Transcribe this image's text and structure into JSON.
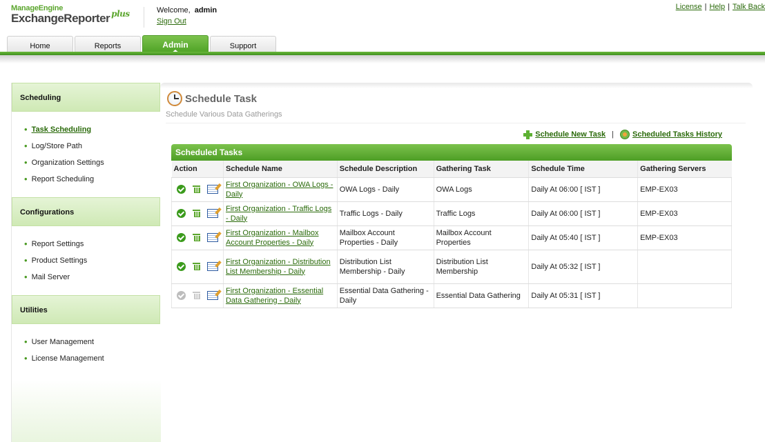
{
  "app": {
    "brand_top": "ManageEngine",
    "brand_main": "ExchangeReporter",
    "brand_plus": "plus"
  },
  "user": {
    "welcome_label": "Welcome,",
    "username": "admin",
    "signout_label": "Sign Out"
  },
  "top_links": {
    "license": "License",
    "help": "Help",
    "talkback": "Talk Back",
    "separator": "|"
  },
  "tabs": [
    {
      "label": "Home",
      "active": false
    },
    {
      "label": "Reports",
      "active": false
    },
    {
      "label": "Admin",
      "active": true
    },
    {
      "label": "Support",
      "active": false
    }
  ],
  "sidebar": {
    "sections": [
      {
        "title": "Scheduling",
        "items": [
          {
            "label": "Task Scheduling",
            "active": true
          },
          {
            "label": "Log/Store Path",
            "active": false
          },
          {
            "label": "Organization Settings",
            "active": false
          },
          {
            "label": "Report Scheduling",
            "active": false
          }
        ]
      },
      {
        "title": "Configurations",
        "items": [
          {
            "label": "Report Settings",
            "active": false
          },
          {
            "label": "Product Settings",
            "active": false
          },
          {
            "label": "Mail Server",
            "active": false
          }
        ]
      },
      {
        "title": "Utilities",
        "items": [
          {
            "label": "User Management",
            "active": false
          },
          {
            "label": "License Management",
            "active": false
          }
        ]
      }
    ]
  },
  "page": {
    "title": "Schedule Task",
    "subtitle": "Schedule Various Data Gatherings",
    "new_task_label": "Schedule New Task",
    "history_label": "Scheduled Tasks History",
    "action_separator": "|"
  },
  "table": {
    "title": "Scheduled Tasks",
    "columns": [
      "Action",
      "Schedule Name",
      "Schedule Description",
      "Gathering Task",
      "Schedule Time",
      "Gathering Servers"
    ],
    "rows": [
      {
        "enabled": true,
        "name": "First Organization - OWA Logs - Daily",
        "description": "OWA Logs - Daily",
        "task": "OWA Logs",
        "time": "Daily At 06:00 [ IST ]",
        "servers": "EMP-EX03"
      },
      {
        "enabled": true,
        "name": "First Organization - Traffic Logs - Daily",
        "description": "Traffic Logs - Daily",
        "task": "Traffic Logs",
        "time": "Daily At 06:00 [ IST ]",
        "servers": "EMP-EX03"
      },
      {
        "enabled": true,
        "name": "First Organization - Mailbox Account Properties - Daily",
        "description": "Mailbox Account Properties - Daily",
        "task": "Mailbox Account Properties",
        "time": "Daily At 05:40 [ IST ]",
        "servers": "EMP-EX03"
      },
      {
        "enabled": true,
        "name": "First Organization - Distribution List Membership - Daily",
        "description": "Distribution List Membership - Daily",
        "task": "Distribution List Membership",
        "time": "Daily At 05:32 [ IST ]",
        "servers": ""
      },
      {
        "enabled": false,
        "name": "First Organization - Essential Data Gathering - Daily",
        "description": "Essential Data Gathering - Daily",
        "task": "Essential Data Gathering",
        "time": "Daily At 05:31 [ IST ]",
        "servers": ""
      }
    ]
  },
  "colors": {
    "accent_green": "#5aa52c",
    "link_green": "#2a6a0a",
    "sidebar_header_bg": "#d7edc0"
  },
  "icons": {
    "new_task": "plus-icon",
    "history": "history-icon",
    "title": "clock-icon",
    "row_enable": "check-circle-icon",
    "row_delete": "trash-icon",
    "row_edit": "edit-icon"
  }
}
